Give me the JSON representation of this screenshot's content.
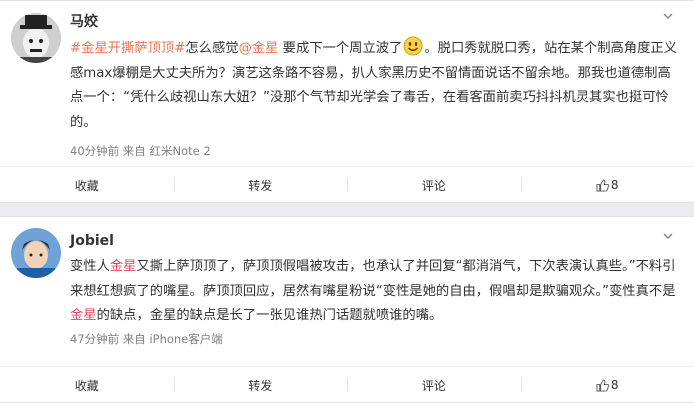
{
  "posts": [
    {
      "username": "马姣",
      "segments": [
        {
          "type": "tag",
          "text": "#金星开撕萨顶顶#"
        },
        {
          "type": "text",
          "text": "怎么感觉"
        },
        {
          "type": "mention",
          "text": "@金星"
        },
        {
          "type": "text",
          "text": " 要成下一个周立波了"
        },
        {
          "type": "emoji",
          "text": ""
        },
        {
          "type": "text",
          "text": "。脱口秀就脱口秀，站在某个制高角度正义感max爆棚是大丈夫所为？演艺这条路不容易，扒人家黑历史不留情面说话不留余地。那我也道德制高点一个：“凭什么歧视山东大妞？”没那个气节却光学会了毒舌，在看客面前卖巧抖抖机灵其实也挺可怜的。"
        }
      ],
      "meta": "40分钟前 来自 红米Note 2",
      "actions": {
        "favorite": "收藏",
        "repost": "转发",
        "comment": "评论",
        "likes": "8"
      }
    },
    {
      "username": "Jobiel",
      "segments": [
        {
          "type": "text",
          "text": "变性人"
        },
        {
          "type": "highlight",
          "text": "金星"
        },
        {
          "type": "text",
          "text": "又撕上萨顶顶了，萨顶顶假唱被攻击，也承认了并回复“都消消气，下次表演认真些。”不料引来想红想疯了的嘴星。萨顶顶回应，居然有嘴星粉说“变性是她的自由，假唱却是欺骗观众。”变性真不是"
        },
        {
          "type": "highlight",
          "text": "金星"
        },
        {
          "type": "text",
          "text": "的缺点，金星的缺点是长了一张见谁热门话题就喷谁的嘴。"
        }
      ],
      "meta": "47分钟前 来自 iPhone客户端",
      "actions": {
        "favorite": "收藏",
        "repost": "转发",
        "comment": "评论",
        "likes": "8"
      }
    }
  ]
}
